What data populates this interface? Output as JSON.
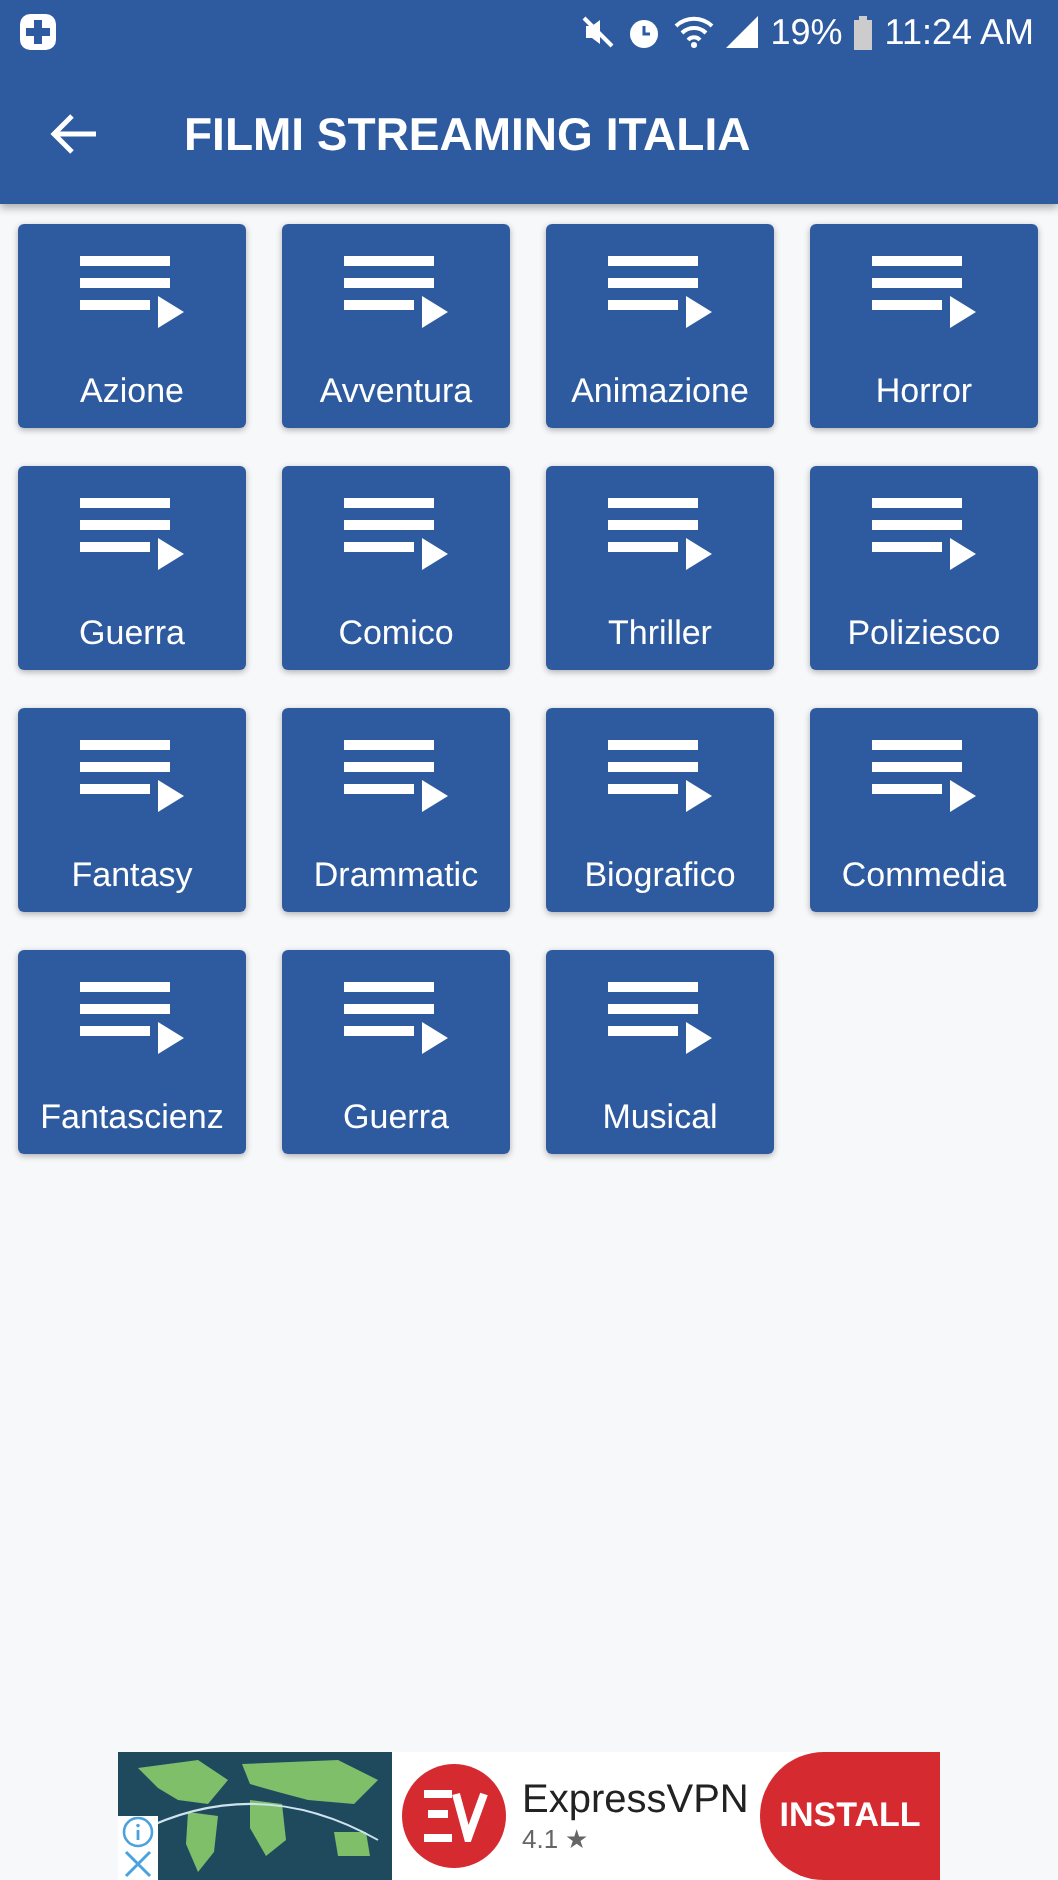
{
  "status_bar": {
    "battery": "19%",
    "time": "11:24 AM"
  },
  "app_bar": {
    "title": "FILMI STREAMING ITALIA"
  },
  "categories": [
    {
      "label": "Azione"
    },
    {
      "label": "Avventura"
    },
    {
      "label": "Animazione"
    },
    {
      "label": "Horror"
    },
    {
      "label": "Guerra"
    },
    {
      "label": "Comico"
    },
    {
      "label": "Thriller"
    },
    {
      "label": "Poliziesco"
    },
    {
      "label": "Fantasy"
    },
    {
      "label": "Drammatic"
    },
    {
      "label": "Biografico"
    },
    {
      "label": "Commedia"
    },
    {
      "label": "Fantascienz"
    },
    {
      "label": "Guerra"
    },
    {
      "label": "Musical"
    }
  ],
  "ad": {
    "kind": "picture",
    "app_name": "ExpressVPN",
    "rating": "4.1",
    "star": "★",
    "button": "INSTALL"
  }
}
